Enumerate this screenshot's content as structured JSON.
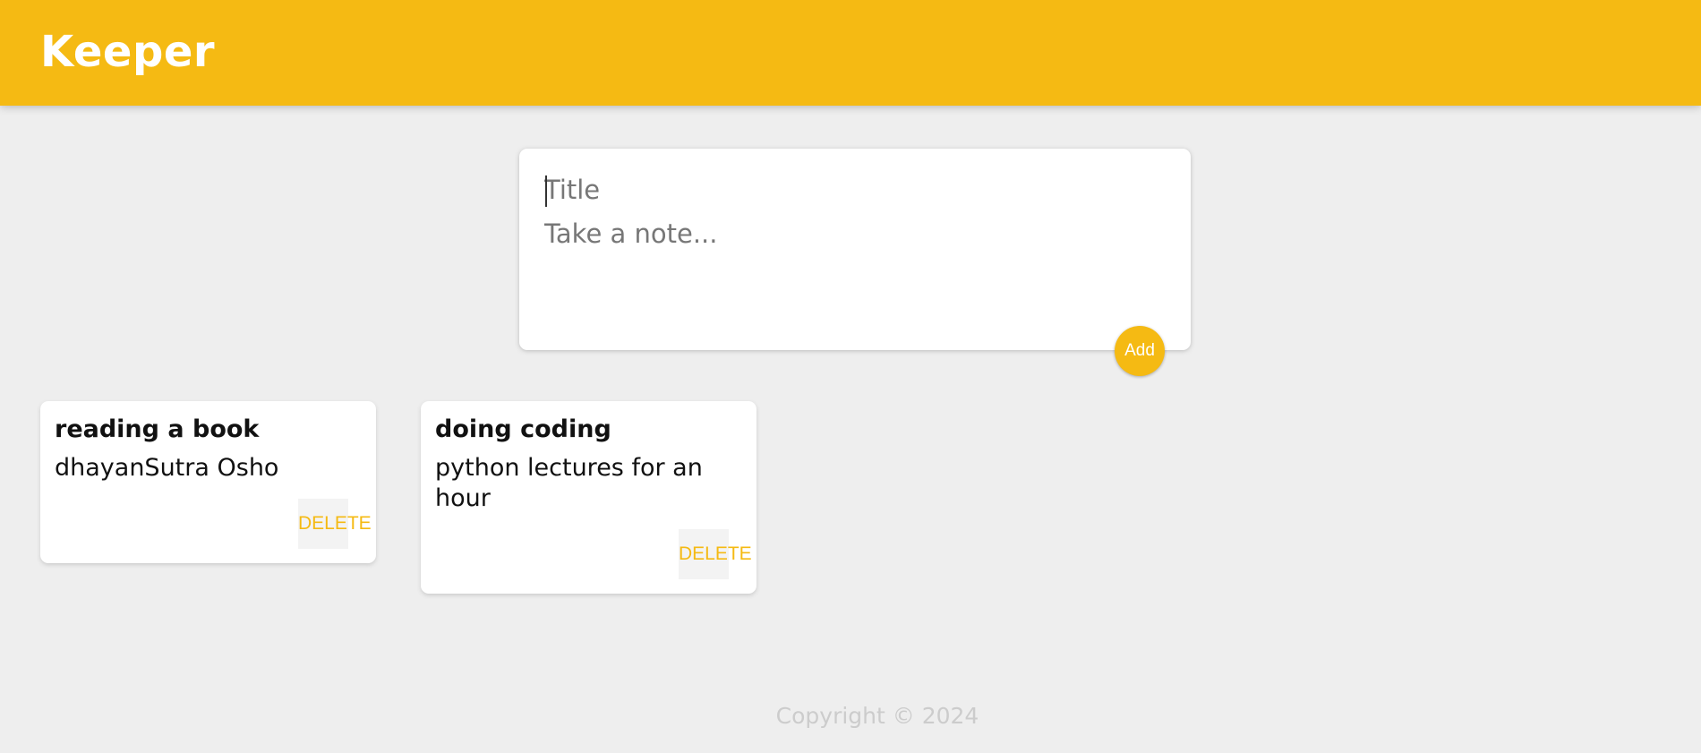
{
  "header": {
    "title": "Keeper"
  },
  "create_note": {
    "title_placeholder": "Title",
    "content_placeholder": "Take a note...",
    "add_label": "Add"
  },
  "notes": [
    {
      "title": "reading a book",
      "content": "dhayanSutra Osho",
      "delete_label": "DELETE"
    },
    {
      "title": "doing coding",
      "content": "python lectures for an hour",
      "delete_label": "DELETE"
    }
  ],
  "footer": {
    "text": "Copyright © 2024"
  },
  "colors": {
    "accent": "#f5ba13",
    "background": "#eeeeee",
    "card": "#ffffff"
  }
}
